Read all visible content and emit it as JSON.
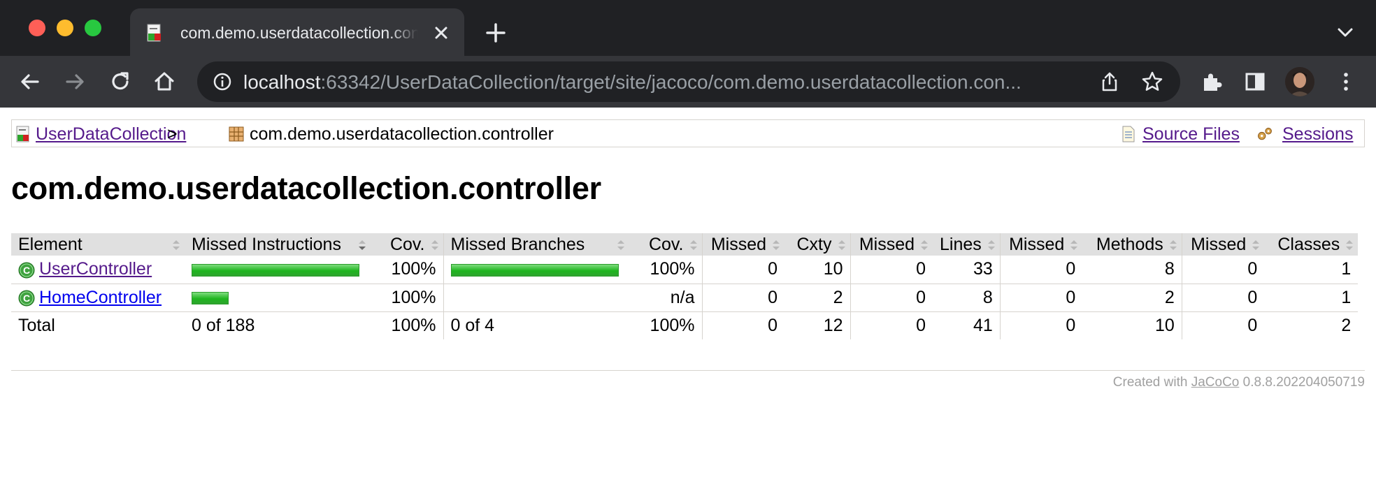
{
  "browser": {
    "tab_title": "com.demo.userdatacollection.controller",
    "url_host": "localhost",
    "url_rest": ":63342/UserDataCollection/target/site/jacoco/com.demo.userdatacollection.con..."
  },
  "breadcrumb": {
    "project_link": "UserDataCollection",
    "separator": ">",
    "package": "com.demo.userdatacollection.controller",
    "source_files_link": "Source Files",
    "sessions_link": "Sessions"
  },
  "page_title": "com.demo.userdatacollection.controller",
  "table": {
    "headers": {
      "element": "Element",
      "missed_instructions": "Missed Instructions",
      "cov1": "Cov.",
      "missed_branches": "Missed Branches",
      "cov2": "Cov.",
      "missed_cxty": "Missed",
      "cxty": "Cxty",
      "missed_lines": "Missed",
      "lines": "Lines",
      "missed_methods": "Missed",
      "methods": "Methods",
      "missed_classes": "Missed",
      "classes": "Classes"
    },
    "rows": [
      {
        "name": "UserController",
        "instr_bar_fraction": 1.0,
        "instr_cov": "100%",
        "branch_bar_fraction": 1.0,
        "branch_cov": "100%",
        "missed_cxty": "0",
        "cxty": "10",
        "missed_lines": "0",
        "lines": "33",
        "missed_methods": "0",
        "methods": "8",
        "missed_classes": "0",
        "classes": "1"
      },
      {
        "name": "HomeController",
        "instr_bar_fraction": 0.22,
        "instr_cov": "100%",
        "branch_cov": "n/a",
        "missed_cxty": "0",
        "cxty": "2",
        "missed_lines": "0",
        "lines": "8",
        "missed_methods": "0",
        "methods": "2",
        "missed_classes": "0",
        "classes": "1"
      }
    ],
    "total": {
      "label": "Total",
      "missed_instructions": "0 of 188",
      "instr_cov": "100%",
      "missed_branches": "0 of 4",
      "branch_cov": "100%",
      "missed_cxty": "0",
      "cxty": "12",
      "missed_lines": "0",
      "lines": "41",
      "missed_methods": "0",
      "methods": "10",
      "missed_classes": "0",
      "classes": "2"
    }
  },
  "footer": {
    "prefix": "Created with",
    "link": "JaCoCo",
    "version": "0.8.8.202204050719"
  },
  "colors": {
    "coverage_bar": "#1fb51f",
    "header_bg": "#e0e0e0",
    "chrome_dark": "#202124",
    "chrome_toolbar": "#35363a"
  }
}
